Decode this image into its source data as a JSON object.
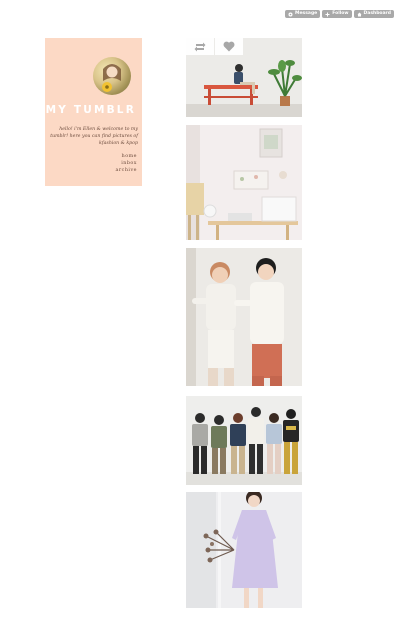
{
  "top_controls": {
    "message_label": "Message",
    "follow_label": "Follow",
    "dashboard_label": "Dashboard"
  },
  "sidebar": {
    "title": "MY TUMBLR",
    "description": "hello! i'm Ellen & welcome to my tumblr! here you can find pictures of kfashion & kpop",
    "nav": [
      "home",
      "inbox",
      "archive"
    ],
    "bg_color": "#fcd9c5"
  },
  "post_actions": {
    "reblog_icon": "reblog-icon",
    "like_icon": "heart-icon"
  },
  "posts": [
    {
      "name": "post-bench-plant"
    },
    {
      "name": "post-white-desk"
    },
    {
      "name": "post-two-men"
    },
    {
      "name": "post-group-six"
    },
    {
      "name": "post-lavender-dress"
    }
  ]
}
